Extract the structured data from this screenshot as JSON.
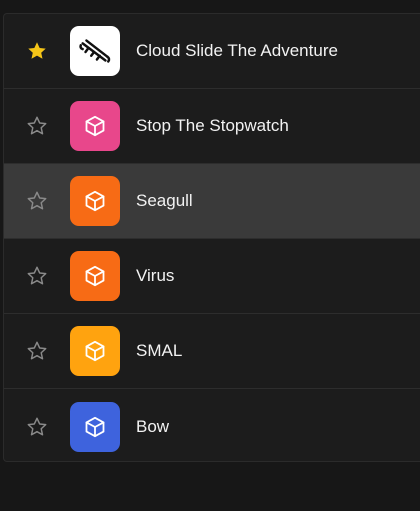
{
  "items": [
    {
      "label": "Cloud Slide The Adventure",
      "starred": true,
      "icon": "sled-icon",
      "tile_color": "#ffffff"
    },
    {
      "label": "Stop The Stopwatch",
      "starred": false,
      "icon": "cube-icon",
      "tile_color": "#e8478b"
    },
    {
      "label": "Seagull",
      "starred": false,
      "icon": "cube-icon",
      "tile_color": "#f76b15"
    },
    {
      "label": "Virus",
      "starred": false,
      "icon": "cube-icon",
      "tile_color": "#f76b15"
    },
    {
      "label": "SMAL",
      "starred": false,
      "icon": "cube-icon",
      "tile_color": "#ffa30f"
    },
    {
      "label": "Bow",
      "starred": false,
      "icon": "cube-icon",
      "tile_color": "#3e63dd"
    }
  ],
  "colors": {
    "star_filled": "#f5c518",
    "star_outline": "#8a8a8a",
    "background": "#171717",
    "list_background": "#1c1c1c",
    "hover_row": "#3a3a3a"
  }
}
